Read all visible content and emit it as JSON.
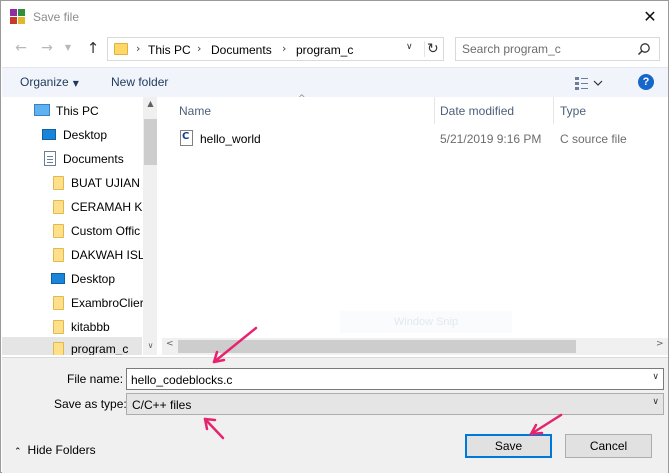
{
  "window": {
    "title": "Save file",
    "close_glyph": "✕",
    "app_icon": "winrar-style-app-icon"
  },
  "nav": {
    "back_glyph": "←",
    "forward_glyph": "→",
    "recent_glyph": "▼",
    "up_glyph": "↑",
    "breadcrumb": [
      "This PC",
      "Documents",
      "program_c"
    ],
    "separator_glyph": "›",
    "dropdown_glyph": "∨",
    "refresh_glyph": "↻",
    "search_placeholder": "Search program_c"
  },
  "toolbar": {
    "organize_label": "Organize",
    "organize_caret": "▼",
    "new_folder_label": "New folder",
    "help_label": "?"
  },
  "tree": {
    "items": [
      {
        "label": "This PC",
        "icon": "computer-icon"
      },
      {
        "label": "Desktop",
        "icon": "desktop-icon"
      },
      {
        "label": "Documents",
        "icon": "documents-icon"
      },
      {
        "label": "BUAT UJIAN",
        "icon": "folder-icon"
      },
      {
        "label": "CERAMAH KH",
        "icon": "folder-icon"
      },
      {
        "label": "Custom Offic",
        "icon": "folder-icon"
      },
      {
        "label": "DAKWAH ISL",
        "icon": "folder-icon"
      },
      {
        "label": "Desktop",
        "icon": "desktop-icon"
      },
      {
        "label": "ExambroClier",
        "icon": "folder-icon"
      },
      {
        "label": "kitabbb",
        "icon": "folder-icon"
      },
      {
        "label": "program_c",
        "icon": "folder-icon",
        "selected": true
      }
    ],
    "scroll_up_glyph": "▲",
    "scroll_down_glyph": "∨"
  },
  "filelist": {
    "columns": [
      "Name",
      "Date modified",
      "Type"
    ],
    "sort_glyph": "^",
    "rows": [
      {
        "name": "hello_world",
        "date": "5/21/2019 9:16 PM",
        "type": "C source file"
      }
    ],
    "watermark": "Window Snip",
    "scroll_left_glyph": "<",
    "scroll_right_glyph": ">"
  },
  "form": {
    "filename_label": "File name:",
    "filename_value": "hello_codeblocks.c",
    "savetype_label": "Save as type:",
    "savetype_value": "C/C++ files",
    "caret_glyph": "∨"
  },
  "footer": {
    "hide_folders_label": "Hide Folders",
    "hide_folders_glyph": "⌃",
    "save_label": "Save",
    "cancel_label": "Cancel"
  },
  "colors": {
    "accent": "#0078d7",
    "annotation_arrow": "#e6246e",
    "toolbar_bg": "#f1f5fb",
    "footer_bg": "#f0f0f0"
  }
}
